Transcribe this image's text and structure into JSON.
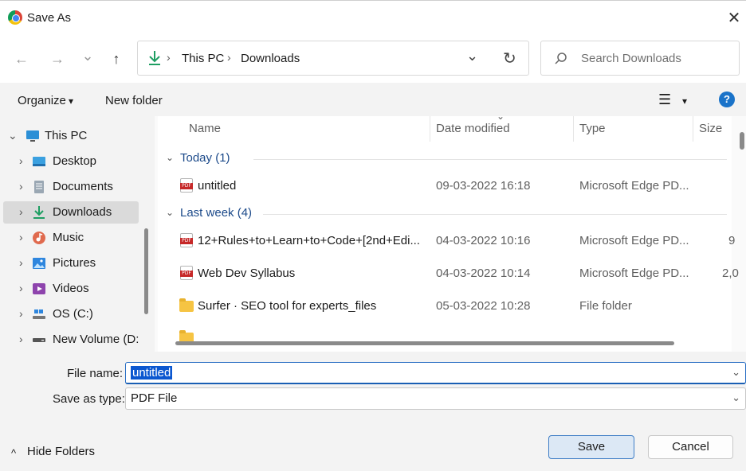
{
  "window": {
    "title": "Save As",
    "close_glyph": "✕"
  },
  "nav": {
    "back_glyph": "←",
    "forward_glyph": "→",
    "recent_glyph": "⌄",
    "up_glyph": "↑",
    "breadcrumb": [
      "This PC",
      "Downloads"
    ],
    "breadcrumb_sep": "›",
    "dropdown_glyph": "⌄",
    "refresh_glyph": "↻",
    "search_placeholder": "Search Downloads"
  },
  "toolbar": {
    "organize": "Organize",
    "organize_glyph": "▾",
    "new_folder": "New folder",
    "view_glyph": "☰",
    "view_chev": "▾",
    "help_glyph": "?"
  },
  "sidebar": {
    "items": [
      {
        "label": "This PC",
        "chevron": "⌄",
        "icon": "monitor-icon"
      },
      {
        "label": "Desktop",
        "chevron": "›",
        "icon": "desktop-icon"
      },
      {
        "label": "Documents",
        "chevron": "›",
        "icon": "documents-icon"
      },
      {
        "label": "Downloads",
        "chevron": "›",
        "icon": "download-icon"
      },
      {
        "label": "Music",
        "chevron": "›",
        "icon": "music-icon"
      },
      {
        "label": "Pictures",
        "chevron": "›",
        "icon": "pictures-icon"
      },
      {
        "label": "Videos",
        "chevron": "›",
        "icon": "videos-icon"
      },
      {
        "label": "OS (C:)",
        "chevron": "›",
        "icon": "drive-icon"
      },
      {
        "label": "New Volume (D:",
        "chevron": "›",
        "icon": "drive-icon"
      }
    ]
  },
  "columns": {
    "name": "Name",
    "date": "Date modified",
    "type": "Type",
    "size": "Size",
    "sort_glyph": "⌄"
  },
  "groups": [
    {
      "label": "Today (1)",
      "chevron": "⌄"
    },
    {
      "label": "Last week (4)",
      "chevron": "⌄"
    }
  ],
  "files": [
    {
      "name": "untitled",
      "date": "09-03-2022 16:18",
      "type": "Microsoft Edge PD...",
      "size": "",
      "icon": "pdf-icon"
    },
    {
      "name": "12+Rules+to+Learn+to+Code+[2nd+Edi...",
      "date": "04-03-2022 10:16",
      "type": "Microsoft Edge PD...",
      "size": "9",
      "icon": "pdf-icon"
    },
    {
      "name": "Web Dev Syllabus",
      "date": "04-03-2022 10:14",
      "type": "Microsoft Edge PD...",
      "size": "2,0",
      "icon": "pdf-icon"
    },
    {
      "name": "Surfer · SEO tool for experts_files",
      "date": "05-03-2022 10:28",
      "type": "File folder",
      "size": "",
      "icon": "folder-icon"
    }
  ],
  "form": {
    "file_name_label": "File name:",
    "file_name_value": "untitled",
    "type_label": "Save as type:",
    "type_value": "PDF File",
    "chev": "⌄"
  },
  "footer": {
    "hide_folders": "Hide Folders",
    "hide_glyph": "^",
    "save": "Save",
    "cancel": "Cancel"
  },
  "colors": {
    "accent": "#0b57d0",
    "download_green": "#1e9e62",
    "help_blue": "#1a73c9",
    "pdf_red": "#c62828"
  }
}
